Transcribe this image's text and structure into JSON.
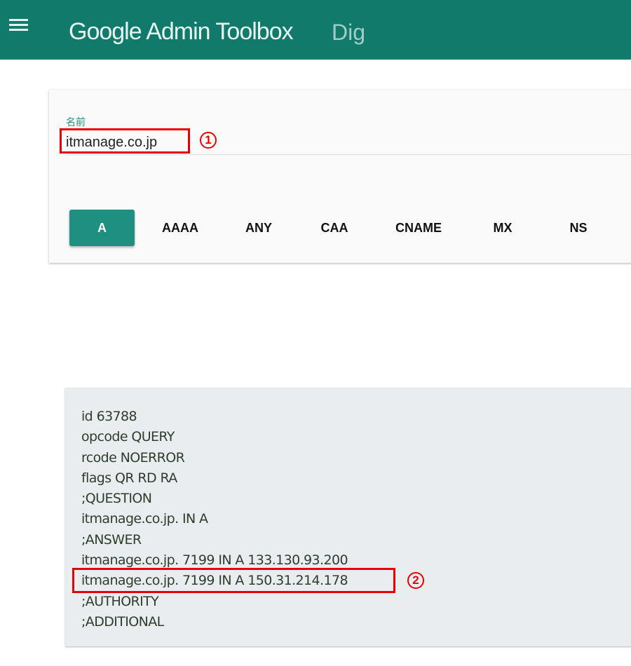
{
  "header": {
    "title": "Google Admin Toolbox",
    "subtitle": "Dig",
    "menu_icon": "hamburger-menu-icon",
    "color": "#117a6a"
  },
  "query": {
    "label": "名前",
    "value": "itmanage.co.jp"
  },
  "record_types": [
    {
      "label": "A",
      "active": true
    },
    {
      "label": "AAAA",
      "active": false
    },
    {
      "label": "ANY",
      "active": false
    },
    {
      "label": "CAA",
      "active": false
    },
    {
      "label": "CNAME",
      "active": false
    },
    {
      "label": "MX",
      "active": false
    },
    {
      "label": "NS",
      "active": false
    }
  ],
  "result": {
    "lines": [
      "id 63788",
      "opcode QUERY",
      "rcode NOERROR",
      "flags QR RD RA",
      ";QUESTION",
      "itmanage.co.jp. IN A",
      ";ANSWER",
      "itmanage.co.jp. 7199 IN A 133.130.93.200",
      "itmanage.co.jp. 7199 IN A 150.31.214.178",
      ";AUTHORITY",
      ";ADDITIONAL"
    ]
  },
  "annotations": {
    "marker1": "1",
    "marker2": "2",
    "highlight_color": "#e60000"
  }
}
